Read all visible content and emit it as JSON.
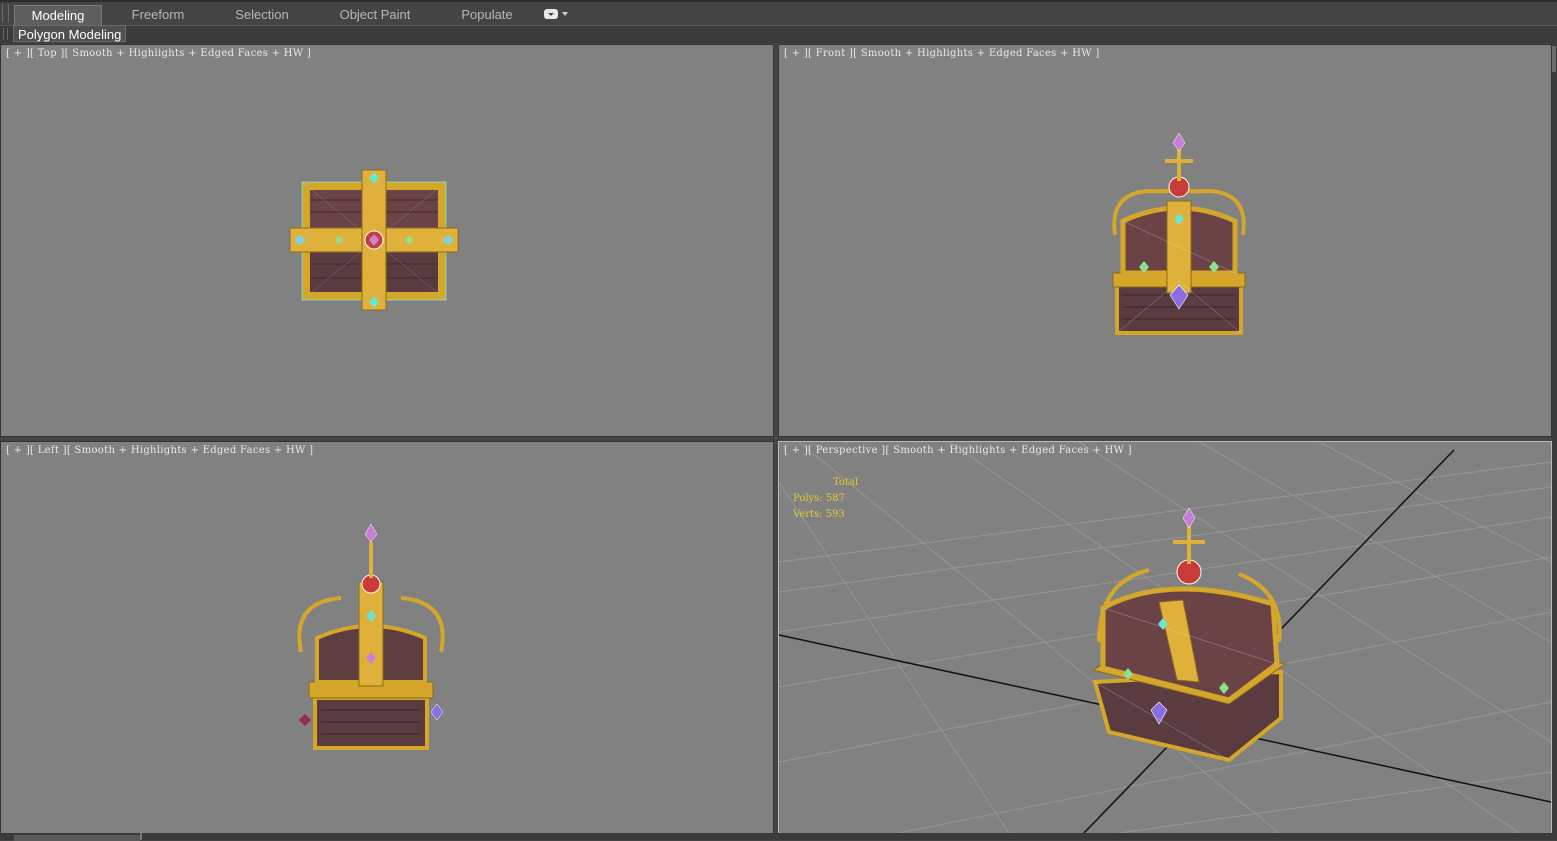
{
  "ribbon": {
    "tabs": [
      {
        "label": "Modeling",
        "active": true
      },
      {
        "label": "Freeform",
        "active": false
      },
      {
        "label": "Selection",
        "active": false
      },
      {
        "label": "Object Paint",
        "active": false
      },
      {
        "label": "Populate",
        "active": false
      }
    ],
    "panel_label": "Polygon Modeling",
    "toggle_icon": "ribbon-toggle-icon"
  },
  "viewports": {
    "top": {
      "label": "[ + ][ Top ][ Smooth + Highlights + Edged Faces + HW ]"
    },
    "front": {
      "label": "[ + ][ Front ][ Smooth + Highlights + Edged Faces + HW ]"
    },
    "left": {
      "label": "[ + ][ Left ][ Smooth + Highlights + Edged Faces + HW ]"
    },
    "perspective": {
      "label": "[ + ][ Perspective ][ Smooth + Highlights + Edged Faces + HW ]",
      "stats": {
        "title": "Total",
        "polys": "Polys: 587",
        "verts": "Verts: 593"
      }
    }
  },
  "colors": {
    "viewport_bg": "#818181",
    "ui_bg": "#444444",
    "stats_text": "#e2cc30",
    "gold": "#d4a62a",
    "wood": "#5a3b3f"
  }
}
